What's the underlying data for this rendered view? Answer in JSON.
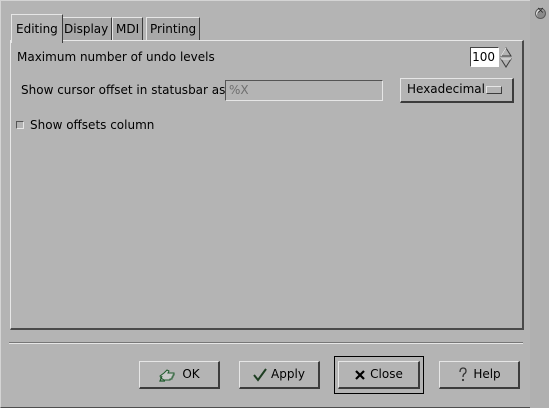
{
  "window": {
    "close_icon": "close-circle-icon"
  },
  "tabs": [
    {
      "label": "Editing",
      "active": true
    },
    {
      "label": "Display",
      "active": false
    },
    {
      "label": "MDI",
      "active": false
    },
    {
      "label": "Printing",
      "active": false
    }
  ],
  "editing": {
    "undo_label": "Maximum number of undo levels",
    "undo_value": "100",
    "cursor_label": "Show cursor offset in statusbar as",
    "cursor_format_value": "%X",
    "offset_base_selected": "Hexadecimal",
    "show_offsets_label": "Show offsets column",
    "show_offsets_checked": false
  },
  "buttons": {
    "ok": {
      "label": "OK",
      "icon": "ok-hand-icon"
    },
    "apply": {
      "label": "Apply",
      "icon": "checkmark-icon"
    },
    "close": {
      "label": "Close",
      "icon": "x-icon"
    },
    "help": {
      "label": "Help",
      "icon": "question-icon"
    }
  }
}
